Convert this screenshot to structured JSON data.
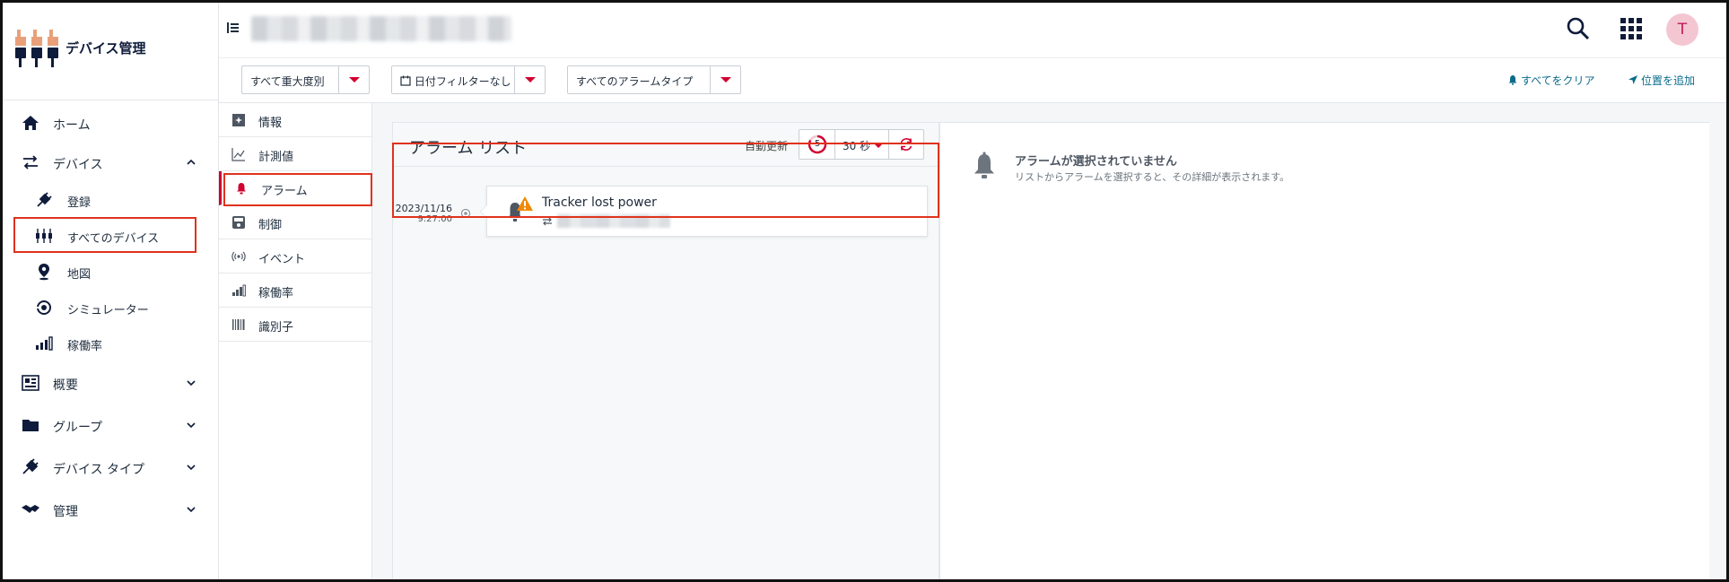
{
  "app": {
    "name": "デバイス管理",
    "user_initial": "T"
  },
  "sidebar": {
    "items": [
      {
        "label": "ホーム",
        "icon": "home-icon"
      },
      {
        "label": "デバイス",
        "icon": "devices-arrows-icon",
        "expanded": true
      },
      {
        "label": "登録",
        "icon": "plug-icon",
        "sub": true
      },
      {
        "label": "すべてのデバイス",
        "icon": "all-devices-icon",
        "sub": true,
        "highlighted": true
      },
      {
        "label": "地図",
        "icon": "map-pin-icon",
        "sub": true
      },
      {
        "label": "シミュレーター",
        "icon": "simulator-icon",
        "sub": true
      },
      {
        "label": "稼働率",
        "icon": "bar-chart-icon",
        "sub": true
      },
      {
        "label": "概要",
        "icon": "overview-icon"
      },
      {
        "label": "グループ",
        "icon": "folder-icon"
      },
      {
        "label": "デバイス タイプ",
        "icon": "device-type-icon"
      },
      {
        "label": "管理",
        "icon": "handshake-icon"
      }
    ]
  },
  "filters": {
    "severity": "すべて重大度別",
    "date": "日付フィルターなし",
    "alarm_type": "すべてのアラームタイプ"
  },
  "actions": {
    "clear_all": "すべてをクリア",
    "add_location": "位置を追加"
  },
  "tabs": [
    {
      "label": "情報",
      "icon": "info-icon"
    },
    {
      "label": "計測値",
      "icon": "measurement-icon"
    },
    {
      "label": "アラーム",
      "icon": "bell-icon",
      "active": true
    },
    {
      "label": "制御",
      "icon": "control-icon"
    },
    {
      "label": "イベント",
      "icon": "event-icon"
    },
    {
      "label": "稼働率",
      "icon": "availability-icon"
    },
    {
      "label": "識別子",
      "icon": "barcode-icon"
    }
  ],
  "alarm_list": {
    "title": "アラーム リスト",
    "auto_refresh_label": "自動更新",
    "countdown": "5",
    "interval": "30 秒",
    "alarms": [
      {
        "date": "2023/11/16",
        "time": "9:27:00",
        "text": "Tracker lost power",
        "severity": "major"
      }
    ]
  },
  "detail": {
    "title": "アラームが選択されていません",
    "subtitle": "リストからアラームを選択すると、その詳細が表示されます。"
  },
  "colors": {
    "accent": "#d0002f",
    "link": "#0b6b8a",
    "highlight_box": "#e0321e",
    "warning": "#f08a00",
    "avatar_bg": "#f4c6d2"
  }
}
